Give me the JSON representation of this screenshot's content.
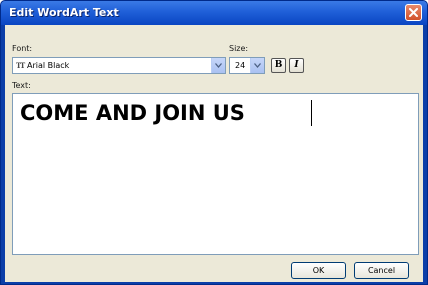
{
  "dialog": {
    "title": "Edit WordArt Text"
  },
  "font": {
    "label": "Font:",
    "value": "Arial Black",
    "icon": "truetype-font-icon"
  },
  "size": {
    "label": "Size:",
    "value": "24"
  },
  "format": {
    "bold_label": "B",
    "italic_label": "I"
  },
  "text": {
    "label": "Text:",
    "value": "COME AND JOIN US"
  },
  "buttons": {
    "ok": "OK",
    "cancel": "Cancel"
  },
  "colors": {
    "titlebar": "#1f5fd8",
    "close": "#d2512b",
    "client": "#ece9d8"
  }
}
